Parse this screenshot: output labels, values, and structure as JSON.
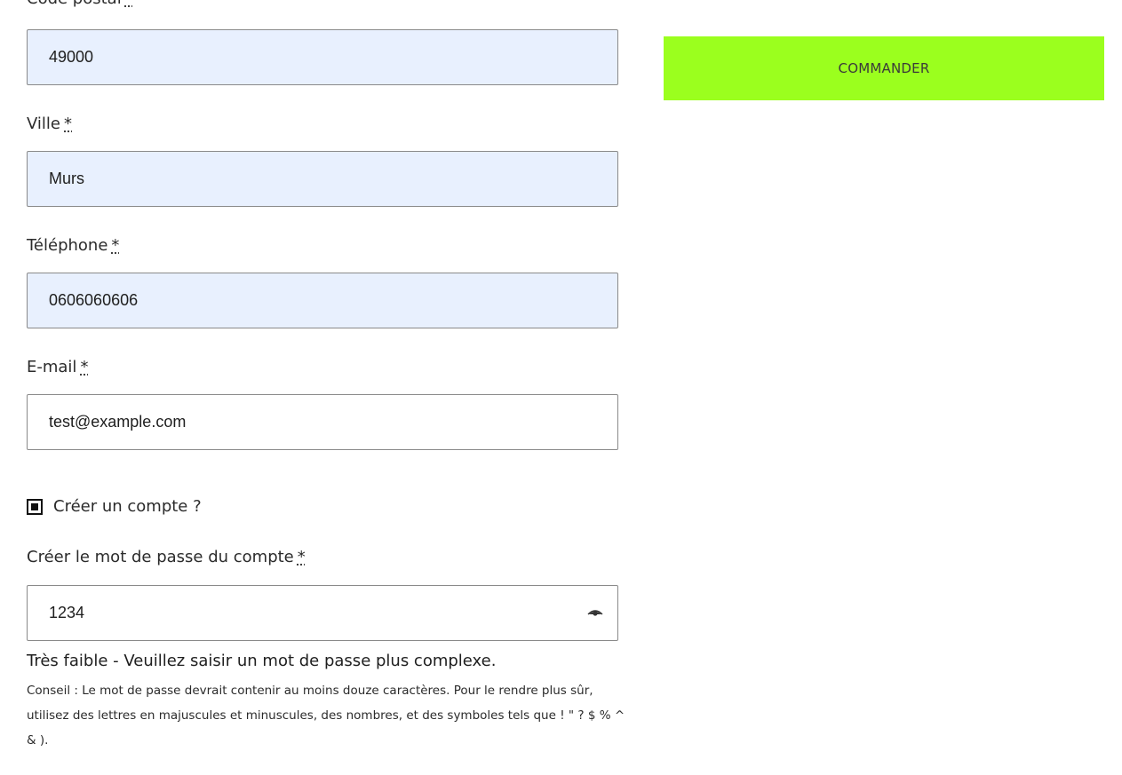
{
  "form": {
    "postal_code": {
      "label": "Code postal",
      "required_mark": "*",
      "value": "49000"
    },
    "city": {
      "label": "Ville",
      "required_mark": "*",
      "value": "Murs"
    },
    "phone": {
      "label": "Téléphone",
      "required_mark": "*",
      "value": "0606060606"
    },
    "email": {
      "label": "E-mail",
      "required_mark": "*",
      "value": "test@example.com"
    },
    "create_account": {
      "label": "Créer un compte ?",
      "checked": true
    },
    "password": {
      "label": "Créer le mot de passe du compte",
      "required_mark": "*",
      "value": "1234",
      "toggle_icon": "eye-icon"
    },
    "password_strength": "Très faible - Veuillez saisir un mot de passe plus complexe.",
    "password_hint": "Conseil : Le mot de passe devrait contenir au moins douze caractères. Pour le rendre plus sûr, utilisez des lettres en majuscules et minuscules, des nombres, et des symboles tels que ! \" ? $ % ^ & )."
  },
  "order_button": {
    "label": "COMMANDER",
    "color": "#9bff1e"
  },
  "colors": {
    "autofill_bg": "#e8f0fe",
    "field_border": "#8a8a8a"
  }
}
